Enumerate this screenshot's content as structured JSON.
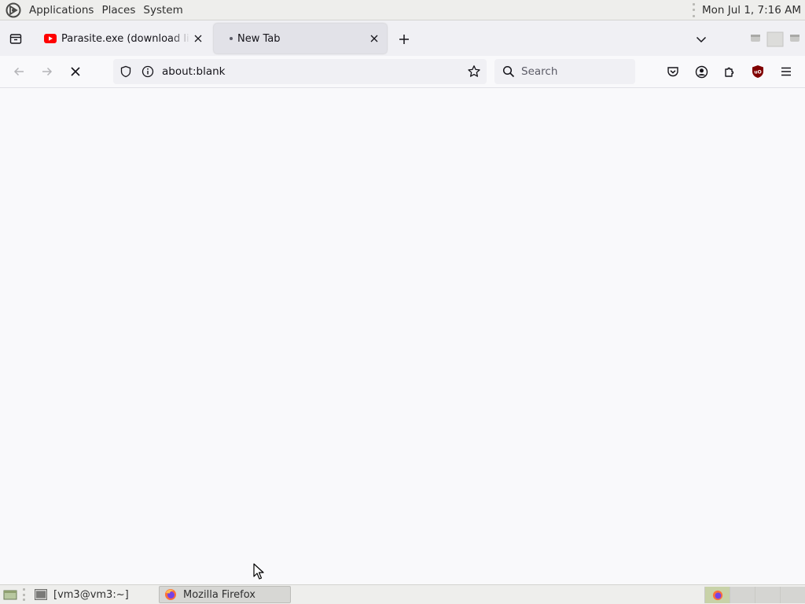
{
  "top_panel": {
    "menus": [
      "Applications",
      "Places",
      "System"
    ],
    "clock": "Mon Jul 1, 7:16 AM"
  },
  "tabs": [
    {
      "title": "Parasite.exe (download link)",
      "favicon": "youtube-icon",
      "active": false
    },
    {
      "title": "New Tab",
      "favicon": "loading-dot",
      "active": true
    }
  ],
  "navbar": {
    "url": "about:blank",
    "search_placeholder": "Search"
  },
  "taskbar": {
    "items": [
      {
        "label": "[vm3@vm3:~]",
        "icon": "terminal-icon"
      },
      {
        "label": "Mozilla Firefox",
        "icon": "firefox-icon"
      }
    ]
  },
  "colors": {
    "youtube_red": "#ff0000",
    "ublock_red": "#800000",
    "panel_bg": "#eeeeec",
    "toolbar_bg": "#f0f0f4"
  }
}
